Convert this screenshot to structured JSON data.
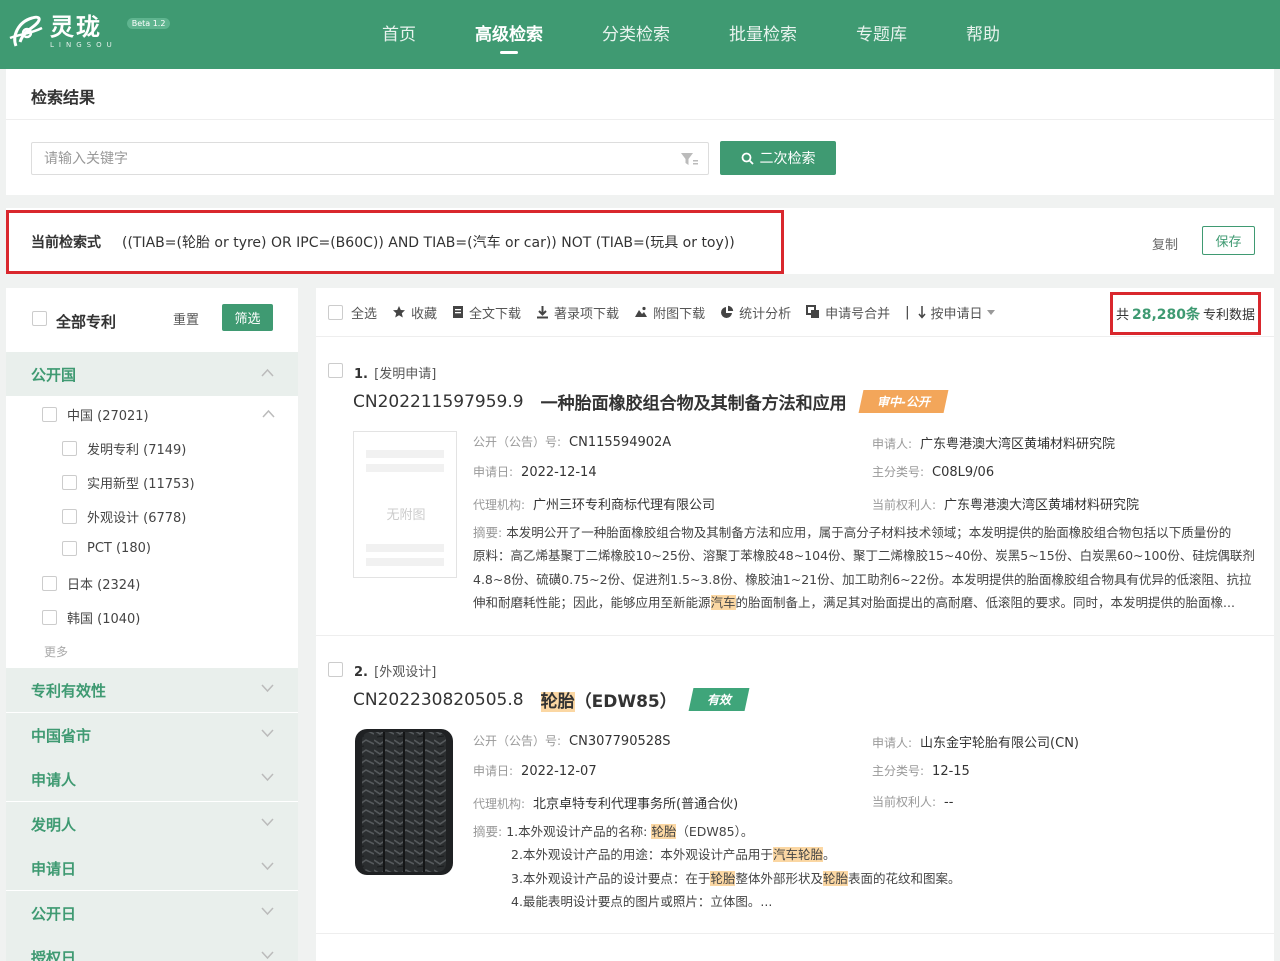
{
  "nav": {
    "logo_name": "灵珑",
    "logo_sub": "LINGSOU",
    "beta": "Beta 1.2",
    "items": [
      {
        "label": "首页",
        "active": false
      },
      {
        "label": "高级检索",
        "active": true
      },
      {
        "label": "分类检索",
        "active": false
      },
      {
        "label": "批量检索",
        "active": false
      },
      {
        "label": "专题库",
        "active": false
      },
      {
        "label": "帮助",
        "active": false
      }
    ]
  },
  "header": {
    "title": "检索结果",
    "search_placeholder": "请输入关键字",
    "research_label": "二次检索"
  },
  "query": {
    "label": "当前检索式",
    "text": "((TIAB=(轮胎 or tyre) OR IPC=(B60C)) AND TIAB=(汽车 or car)) NOT (TIAB=(玩具 or toy))",
    "copy_label": "复制",
    "save_label": "保存"
  },
  "sidebar": {
    "all_label": "全部专利",
    "reset_label": "重置",
    "filter_label": "筛选",
    "facets": [
      "公开国",
      "专利有效性",
      "中国省市",
      "申请人",
      "发明人",
      "申请日",
      "公开日",
      "授权日"
    ],
    "country_options": [
      {
        "label": "中国 (27021)",
        "level": 1
      },
      {
        "label": "发明专利 (7149)",
        "level": 2
      },
      {
        "label": "实用新型 (11753)",
        "level": 2
      },
      {
        "label": "外观设计 (6778)",
        "level": 2
      },
      {
        "label": "PCT (180)",
        "level": 2
      },
      {
        "label": "日本 (2324)",
        "level": 1
      },
      {
        "label": "韩国 (1040)",
        "level": 1
      }
    ],
    "more_label": "更多"
  },
  "toolbar": {
    "select_all": "全选",
    "collect": "收藏",
    "fulltext_download": "全文下载",
    "biblio_download": "著录项下载",
    "figure_download": "附图下载",
    "stats": "统计分析",
    "merge": "申请号合并",
    "sort_sep": "|",
    "sort": "按申请日",
    "total_prefix": "共",
    "total_count": "28,280条",
    "total_suffix": "专利数据"
  },
  "records": [
    {
      "index": "1.",
      "type": "[发明申请]",
      "number": "CN202211597959.9",
      "title": "一种胎面橡胶组合物及其制备方法和应用",
      "status": "审中-公开",
      "nopic": "无附图",
      "pub_label": "公开（公告）号:",
      "pub_no": "CN115594902A",
      "applicant_label": "申请人:",
      "applicant": "广东粤港澳大湾区黄埔材料研究院",
      "date_label": "申请日:",
      "date": "2022-12-14",
      "ipc_label": "主分类号:",
      "ipc": "C08L9/06",
      "agency_label": "代理机构:",
      "agency": "广州三环专利商标代理有限公司",
      "owner_label": "当前权利人:",
      "owner": "广东粤港澳大湾区黄埔材料研究院",
      "abstract_label": "摘要:",
      "abs_line1": "本发明公开了一种胎面橡胶组合物及其制备方法和应用，属于高分子材料技术领域；本发明提供的胎面橡胶组合物包括以下质量份的",
      "abs_line2": "原料：高乙烯基聚丁二烯橡胶10~25份、溶聚丁苯橡胶48~104份、聚丁二烯橡胶15~40份、炭黑5~15份、白炭黑60~100份、硅烷偶联剂",
      "abs_line3": "4.8~8份、硫磺0.75~2份、促进剂1.5~3.8份、橡胶油1~21份、加工助剂6~22份。本发明提供的胎面橡胶组合物具有优异的低滚阻、抗拉",
      "abs_line4a": "伸和耐磨耗性能；因此，能够应用至新能源",
      "abs_line4hl": "汽车",
      "abs_line4b": "的胎面制备上，满足其对胎面提出的高耐磨、低滚阻的要求。同时，本发明提供的胎面橡..."
    },
    {
      "index": "2.",
      "type": "[外观设计]",
      "number": "CN202230820505.8",
      "title_hl": "轮胎",
      "title_rest": "（EDW85）",
      "status": "有效",
      "pub_label": "公开（公告）号:",
      "pub_no": "CN307790528S",
      "applicant_label": "申请人:",
      "applicant": "山东金宇轮胎有限公司(CN)",
      "date_label": "申请日:",
      "date": "2022-12-07",
      "ipc_label": "主分类号:",
      "ipc": "12-15",
      "agency_label": "代理机构:",
      "agency": "北京卓特专利代理事务所(普通合伙)",
      "owner_label": "当前权利人:",
      "owner": "--",
      "abstract_label": "摘要:",
      "abs1a": "1.本外观设计产品的名称: ",
      "abs1hl": "轮胎",
      "abs1b": "（EDW85）。",
      "abs2a": "2.本外观设计产品的用途：本外观设计产品用于",
      "abs2hl": "汽车轮胎",
      "abs2b": "。",
      "abs3a": "3.本外观设计产品的设计要点：在于",
      "abs3hl1": "轮胎",
      "abs3b": "整体外部形状及",
      "abs3hl2": "轮胎",
      "abs3c": "表面的花纹和图案。",
      "abs4": "4.最能表明设计要点的图片或照片：立体图。..."
    }
  ],
  "colors": {
    "brand": "#3f9a72",
    "highlight_box": "#d9272d",
    "tag_orange": "#f3a65a",
    "tag_green": "#3fa57a",
    "keyword_highlight": "#fbd7a3"
  }
}
